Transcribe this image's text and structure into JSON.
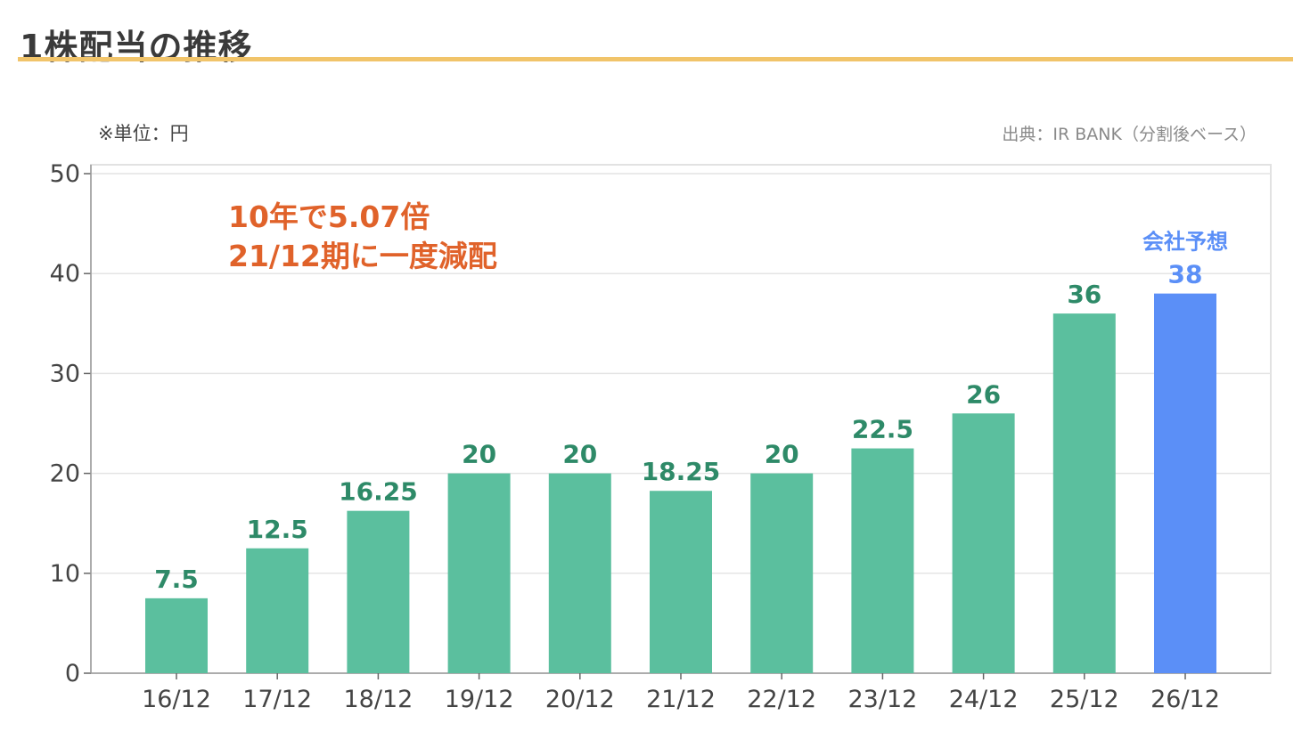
{
  "header": {
    "title": "1株配当の推移"
  },
  "notes": {
    "unit": "※単位：円",
    "source": "出典：IR BANK（分割後ベース）"
  },
  "annotation": {
    "line1": "10年で5.07倍",
    "line2": "21/12期に一度減配"
  },
  "colors": {
    "actual_bar": "#5bbf9e",
    "actual_label": "#2e8a68",
    "forecast_bar": "#5b8ff7",
    "forecast_label": "#5b8ff7",
    "annotation": "#e0622a",
    "title_rule": "#f1c46a"
  },
  "chart_data": {
    "type": "bar",
    "categories": [
      "16/12",
      "17/12",
      "18/12",
      "19/12",
      "20/12",
      "21/12",
      "22/12",
      "23/12",
      "24/12",
      "25/12",
      "26/12"
    ],
    "values": [
      7.5,
      12.5,
      16.25,
      20,
      20,
      18.25,
      20,
      22.5,
      26,
      36,
      38
    ],
    "value_labels": [
      "7.5",
      "12.5",
      "16.25",
      "20",
      "20",
      "18.25",
      "20",
      "22.5",
      "26",
      "36",
      "38"
    ],
    "forecast_index": 10,
    "forecast_label": "会社予想",
    "ylim": [
      0,
      50
    ],
    "yticks": [
      0,
      10,
      20,
      30,
      40,
      50
    ],
    "grid": true,
    "title": "",
    "xlabel": "",
    "ylabel": ""
  }
}
